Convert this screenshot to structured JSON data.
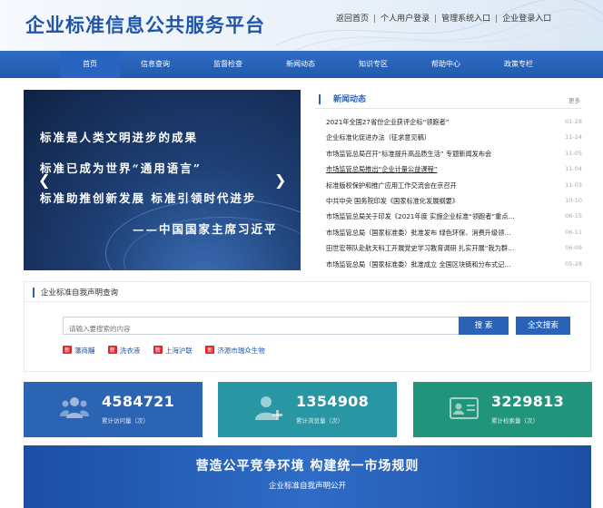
{
  "header": {
    "site_title": "企业标准信息公共服务平台",
    "links": [
      "返回首页",
      "个人用户登录",
      "管理系统入口",
      "企业登录入口"
    ],
    "separator": "|"
  },
  "nav": {
    "items": [
      "首页",
      "信息查询",
      "监督检查",
      "新闻动态",
      "知识专区",
      "帮助中心",
      "政策专栏"
    ],
    "active_index": 0
  },
  "banner": {
    "lines": [
      "标准是人类文明进步的成果",
      "标准已成为世界“通用语言”",
      "标准助推创新发展   标准引领时代进步"
    ],
    "signature": "——中国国家主席习近平",
    "prev": "❮",
    "next": "❯"
  },
  "news": {
    "title": "新闻动态",
    "more": "更多",
    "items": [
      {
        "title": "2021年全国27省份企业获评企标“领跑者”",
        "date": "01-28"
      },
      {
        "title": "企业标准化促进办法（征求意见稿）",
        "date": "11-24"
      },
      {
        "title": "市场监管总局召开“标准提升高品质生活” 专题新闻发布会",
        "date": "11-05"
      },
      {
        "title": "市场监管总局推出“企业计量公益课程”",
        "date": "11-04"
      },
      {
        "title": "标准版权保护和推广应用工作交流会在京召开",
        "date": "11-03"
      },
      {
        "title": "中共中央 国务院印发《国家标准化发展纲要》",
        "date": "10-10"
      },
      {
        "title": "市场监管总局关于印发《2021年度 实施企业标准“领跑者”重点…",
        "date": "06-15"
      },
      {
        "title": "市场监管总局（国家标准委）批准发布 绿色环保、消费升级领…",
        "date": "06-11"
      },
      {
        "title": "田世宏带队赴航天科工开展党史学习教育调研 扎实开展“我为群…",
        "date": "06-09"
      },
      {
        "title": "市场监管总局（国家标准委）批准成立 全国区块链和分布式记…",
        "date": "05-28"
      }
    ]
  },
  "query": {
    "title": "企业标准自我声明查询",
    "placeholder": "请输入要搜索的内容",
    "search_button": "搜 索",
    "fulltext_button": "全文搜索",
    "new_badge": "新",
    "tags": [
      "藩商黼",
      "洗衣液",
      "上海沪联",
      "济源市瑞众生物"
    ]
  },
  "stats": [
    {
      "value": "4584721",
      "label": "累计访问量（次）",
      "icon": "users-icon",
      "color": "#2c64b4"
    },
    {
      "value": "1354908",
      "label": "累计浏览量（次）",
      "icon": "user-add-icon",
      "color": "#2996a3"
    },
    {
      "value": "3229813",
      "label": "累计检索量（次）",
      "icon": "id-card-icon",
      "color": "#21957b"
    }
  ],
  "promo": {
    "headline": "营造公平竞争环境  构建统一市场规则",
    "subline": "企业标准自我声明公开"
  }
}
